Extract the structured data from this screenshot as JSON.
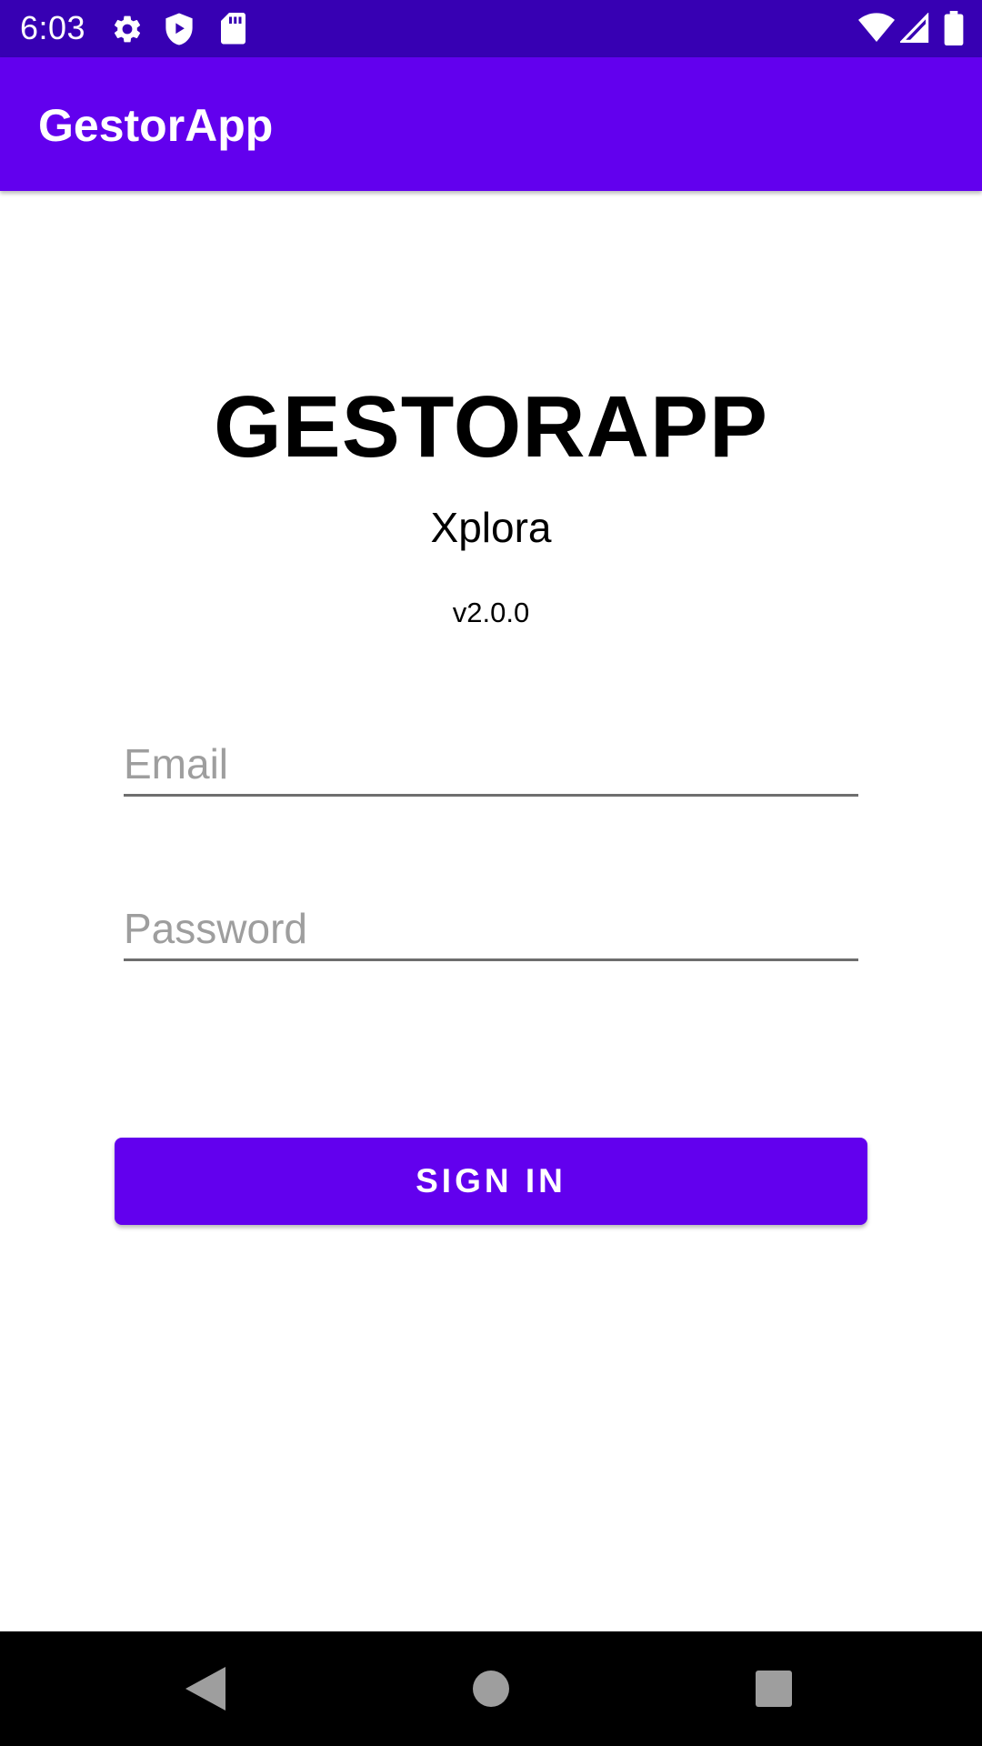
{
  "status_bar": {
    "time": "6:03",
    "icons": [
      "settings-gear-icon",
      "shield-play-icon",
      "sd-card-icon",
      "wifi-icon",
      "signal-icon",
      "battery-icon"
    ],
    "background_color": "#3700B3"
  },
  "app_bar": {
    "title": "GestorApp",
    "background_color": "#6200EE"
  },
  "login": {
    "brand_title": "GESTORAPP",
    "subtitle": "Xplora",
    "version": "v2.0.0",
    "email": {
      "placeholder": "Email",
      "value": ""
    },
    "password": {
      "placeholder": "Password",
      "value": ""
    },
    "sign_in_label": "SIGN IN",
    "accent_color": "#6200EE"
  },
  "nav_bar": {
    "buttons": [
      "back-icon",
      "home-icon",
      "recents-icon"
    ]
  }
}
